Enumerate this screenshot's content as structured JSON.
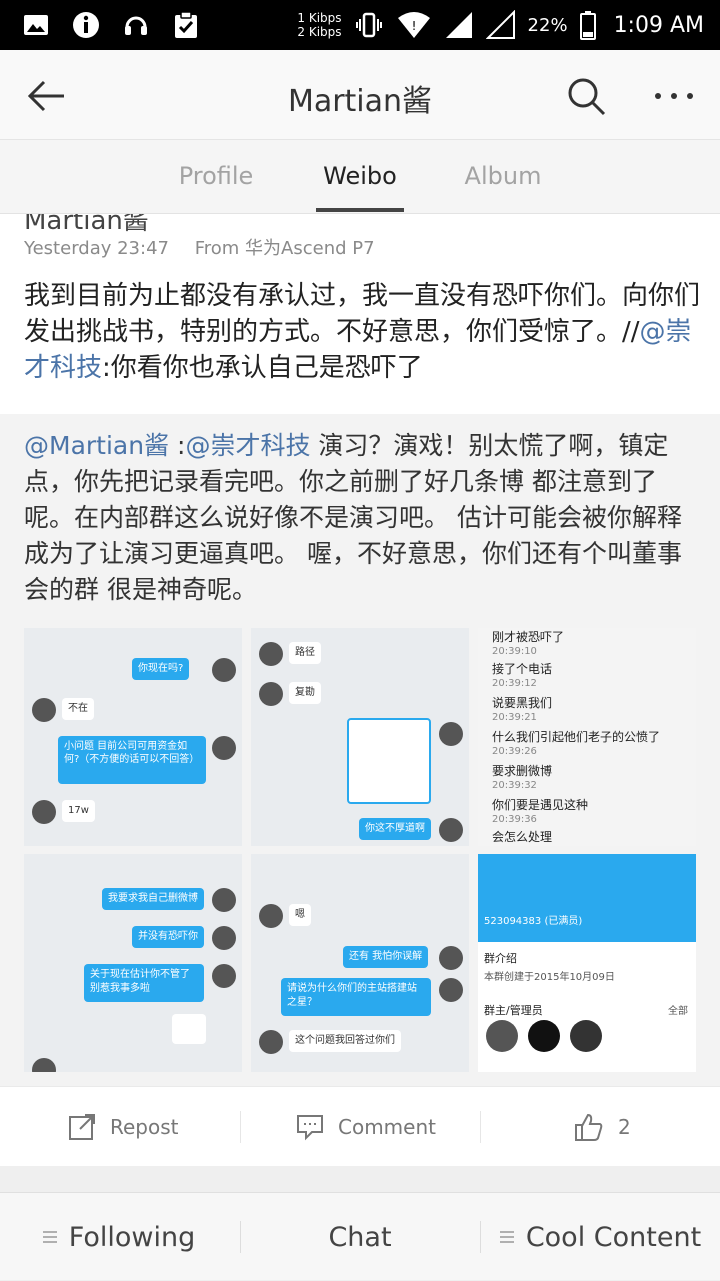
{
  "status_bar": {
    "speed_up": "1 Kibps",
    "speed_down": "2 Kibps",
    "battery_percent": "22%",
    "time": "1:09 AM",
    "icons": [
      "gallery-icon",
      "info-icon",
      "headset-icon",
      "clipboard-check-icon",
      "vibrate-icon",
      "wifi-icon",
      "signal-icon",
      "signal-icon",
      "battery-icon"
    ]
  },
  "app_bar": {
    "title": "Martian酱",
    "icons": [
      "back-arrow-icon",
      "search-icon",
      "more-icon"
    ]
  },
  "tabs": [
    {
      "label": "Profile",
      "active": false
    },
    {
      "label": "Weibo",
      "active": true
    },
    {
      "label": "Album",
      "active": false
    }
  ],
  "post": {
    "author_partial": "Martian酱",
    "time": "Yesterday 23:47",
    "source": "From 华为Ascend P7",
    "text_before": "我到目前为止都没有承认过，我一直没有恐吓你们。向你们发出挑战书，特别的方式。不好意思，你们受惊了。//",
    "mention": "@崇才科技",
    "text_after": ":你看你也承认自己是恐吓了"
  },
  "quoted": {
    "mention_1": "@Martian酱",
    "sep": " :",
    "mention_2": "@崇才科技",
    "text": " 演习？演戏！别太慌了啊，镇定点，你先把记录看完吧。你之前删了好几条博 都注意到了呢。在内部群这么说好像不是演习吧。 估计可能会被你解释成为了让演习更逼真吧。 喔，不好意思，你们还有个叫董事会的群 很是神奇呢。"
  },
  "images": {
    "t1": [
      "你现在吗?",
      "不在",
      "小问题 目前公司可用资金如何?（不方便的话可以不回答）",
      "17w"
    ],
    "t2": [
      "路径",
      "复勘",
      "你这不厚道啊"
    ],
    "t3": [
      {
        "line": "刚才被恐吓了",
        "ts": "20:39:10"
      },
      {
        "line": "接了个电话",
        "ts": "20:39:12"
      },
      {
        "line": "说要黑我们",
        "ts": "20:39:21"
      },
      {
        "line": "什么我们引起他们老子的公愤了",
        "ts": "20:39:26"
      },
      {
        "line": "要求删微博",
        "ts": "20:39:32"
      },
      {
        "line": "你们要是遇见这种",
        "ts": "20:39:36"
      },
      {
        "line": "会怎么处理",
        "ts": ""
      }
    ],
    "t4": [
      "我要求我自己删微博",
      "并没有恐吓你",
      "关于现在估计你不管了 别惹我事多啦"
    ],
    "t5": [
      "嗯",
      "还有 我怕你误解",
      "请说为什么你们的主站搭建站之星？",
      "这个问题我回答过你们"
    ],
    "t6": [
      "523094383 (已满员)",
      "群介绍",
      "本群创建于2015年10月09日",
      "群主/管理员",
      "全部"
    ]
  },
  "actions": {
    "repost": "Repost",
    "comment": "Comment",
    "likes": "2"
  },
  "bottom_nav": [
    {
      "label": "Following"
    },
    {
      "label": "Chat"
    },
    {
      "label": "Cool Content"
    }
  ],
  "colors": {
    "link": "#4b74a8",
    "chat_bubble": "#2aa9ee"
  }
}
